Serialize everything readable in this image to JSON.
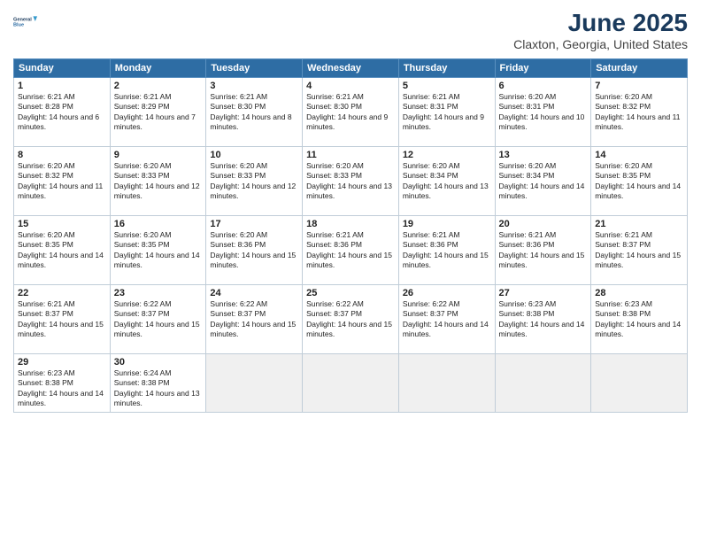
{
  "logo": {
    "line1": "General",
    "line2": "Blue"
  },
  "title": "June 2025",
  "location": "Claxton, Georgia, United States",
  "headers": [
    "Sunday",
    "Monday",
    "Tuesday",
    "Wednesday",
    "Thursday",
    "Friday",
    "Saturday"
  ],
  "weeks": [
    [
      {
        "day": "1",
        "sunrise": "6:21 AM",
        "sunset": "8:28 PM",
        "daylight": "14 hours and 6 minutes."
      },
      {
        "day": "2",
        "sunrise": "6:21 AM",
        "sunset": "8:29 PM",
        "daylight": "14 hours and 7 minutes."
      },
      {
        "day": "3",
        "sunrise": "6:21 AM",
        "sunset": "8:30 PM",
        "daylight": "14 hours and 8 minutes."
      },
      {
        "day": "4",
        "sunrise": "6:21 AM",
        "sunset": "8:30 PM",
        "daylight": "14 hours and 9 minutes."
      },
      {
        "day": "5",
        "sunrise": "6:21 AM",
        "sunset": "8:31 PM",
        "daylight": "14 hours and 9 minutes."
      },
      {
        "day": "6",
        "sunrise": "6:20 AM",
        "sunset": "8:31 PM",
        "daylight": "14 hours and 10 minutes."
      },
      {
        "day": "7",
        "sunrise": "6:20 AM",
        "sunset": "8:32 PM",
        "daylight": "14 hours and 11 minutes."
      }
    ],
    [
      {
        "day": "8",
        "sunrise": "6:20 AM",
        "sunset": "8:32 PM",
        "daylight": "14 hours and 11 minutes."
      },
      {
        "day": "9",
        "sunrise": "6:20 AM",
        "sunset": "8:33 PM",
        "daylight": "14 hours and 12 minutes."
      },
      {
        "day": "10",
        "sunrise": "6:20 AM",
        "sunset": "8:33 PM",
        "daylight": "14 hours and 12 minutes."
      },
      {
        "day": "11",
        "sunrise": "6:20 AM",
        "sunset": "8:33 PM",
        "daylight": "14 hours and 13 minutes."
      },
      {
        "day": "12",
        "sunrise": "6:20 AM",
        "sunset": "8:34 PM",
        "daylight": "14 hours and 13 minutes."
      },
      {
        "day": "13",
        "sunrise": "6:20 AM",
        "sunset": "8:34 PM",
        "daylight": "14 hours and 14 minutes."
      },
      {
        "day": "14",
        "sunrise": "6:20 AM",
        "sunset": "8:35 PM",
        "daylight": "14 hours and 14 minutes."
      }
    ],
    [
      {
        "day": "15",
        "sunrise": "6:20 AM",
        "sunset": "8:35 PM",
        "daylight": "14 hours and 14 minutes."
      },
      {
        "day": "16",
        "sunrise": "6:20 AM",
        "sunset": "8:35 PM",
        "daylight": "14 hours and 14 minutes."
      },
      {
        "day": "17",
        "sunrise": "6:20 AM",
        "sunset": "8:36 PM",
        "daylight": "14 hours and 15 minutes."
      },
      {
        "day": "18",
        "sunrise": "6:21 AM",
        "sunset": "8:36 PM",
        "daylight": "14 hours and 15 minutes."
      },
      {
        "day": "19",
        "sunrise": "6:21 AM",
        "sunset": "8:36 PM",
        "daylight": "14 hours and 15 minutes."
      },
      {
        "day": "20",
        "sunrise": "6:21 AM",
        "sunset": "8:36 PM",
        "daylight": "14 hours and 15 minutes."
      },
      {
        "day": "21",
        "sunrise": "6:21 AM",
        "sunset": "8:37 PM",
        "daylight": "14 hours and 15 minutes."
      }
    ],
    [
      {
        "day": "22",
        "sunrise": "6:21 AM",
        "sunset": "8:37 PM",
        "daylight": "14 hours and 15 minutes."
      },
      {
        "day": "23",
        "sunrise": "6:22 AM",
        "sunset": "8:37 PM",
        "daylight": "14 hours and 15 minutes."
      },
      {
        "day": "24",
        "sunrise": "6:22 AM",
        "sunset": "8:37 PM",
        "daylight": "14 hours and 15 minutes."
      },
      {
        "day": "25",
        "sunrise": "6:22 AM",
        "sunset": "8:37 PM",
        "daylight": "14 hours and 15 minutes."
      },
      {
        "day": "26",
        "sunrise": "6:22 AM",
        "sunset": "8:37 PM",
        "daylight": "14 hours and 14 minutes."
      },
      {
        "day": "27",
        "sunrise": "6:23 AM",
        "sunset": "8:38 PM",
        "daylight": "14 hours and 14 minutes."
      },
      {
        "day": "28",
        "sunrise": "6:23 AM",
        "sunset": "8:38 PM",
        "daylight": "14 hours and 14 minutes."
      }
    ],
    [
      {
        "day": "29",
        "sunrise": "6:23 AM",
        "sunset": "8:38 PM",
        "daylight": "14 hours and 14 minutes."
      },
      {
        "day": "30",
        "sunrise": "6:24 AM",
        "sunset": "8:38 PM",
        "daylight": "14 hours and 13 minutes."
      },
      null,
      null,
      null,
      null,
      null
    ]
  ],
  "labels": {
    "sunrise": "Sunrise:",
    "sunset": "Sunset:",
    "daylight": "Daylight:"
  }
}
